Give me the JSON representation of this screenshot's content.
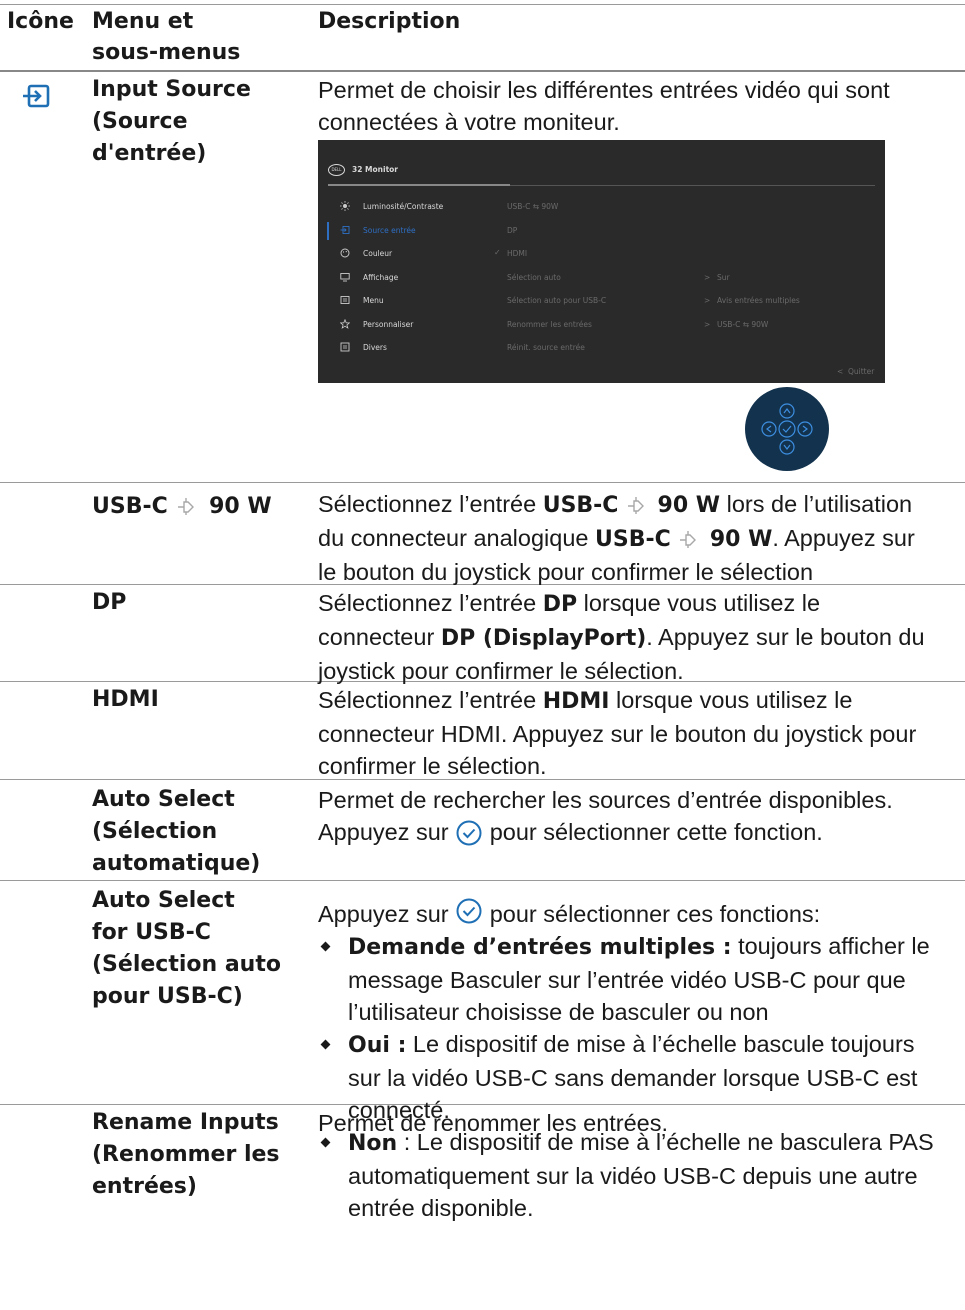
{
  "header": {
    "col_icon": "Icône",
    "col_menu_1": "Menu et",
    "col_menu_2": "sous-menus",
    "col_desc": "Description"
  },
  "rows": {
    "input_source": {
      "menu": [
        "Input Source",
        "(Source",
        "d'entrée)"
      ],
      "desc": [
        "Permet de choisir les différentes entrées vidéo qui sont",
        "connectées à votre moniteur."
      ],
      "icon": "input-source-icon"
    },
    "usbc": {
      "menu_a": "USB-C",
      "menu_b": "90 W",
      "l1a": "Sélectionnez l’entrée ",
      "l1b": "USB-C",
      "l1c": "90 W",
      "l1d": " lors de l’utilisation",
      "l2a": "du connecteur analogique ",
      "l2b": "USB-C",
      "l2c": "90 W",
      "l2d": ". Appuyez sur",
      "l3": "le bouton du joystick pour confirmer le sélection"
    },
    "dp": {
      "menu": "DP",
      "l1a": "Sélectionnez l’entrée ",
      "l1b": "DP",
      "l1c": " lorsque vous utilisez le",
      "l2a": "connecteur ",
      "l2b": "DP (DisplayPort)",
      "l2c": ". Appuyez sur le bouton du",
      "l3": "joystick pour confirmer le sélection."
    },
    "hdmi": {
      "menu": "HDMI",
      "l1a": "Sélectionnez l’entrée ",
      "l1b": "HDMI",
      "l1c": " lorsque vous utilisez le",
      "l2": "connecteur HDMI. Appuyez sur le bouton du joystick pour",
      "l3": "confirmer le sélection."
    },
    "auto_select": {
      "menu": [
        "Auto Select",
        "(Sélection",
        "automatique)"
      ],
      "l1": "Permet de rechercher les sources d’entrée disponibles.",
      "l2a": "Appuyez sur ",
      "l2b": " pour sélectionner cette fonction."
    },
    "auto_usbc": {
      "menu": [
        "Auto Select",
        "for USB-C",
        "(Sélection auto",
        "pour USB-C)"
      ],
      "intro_a": "Appuyez sur ",
      "intro_b": " pour sélectionner ces fonctions:",
      "b1_bold": "Demande d’entrées multiples :",
      "b1_l1": " toujours afficher le",
      "b1_l2": "message Basculer sur l’entrée vidéo USB-C pour que",
      "b1_l3": "l’utilisateur choisisse de basculer ou non",
      "b2_bold": "Oui :",
      "b2_l1": " Le dispositif de mise à l’échelle bascule toujours",
      "b2_l2": "sur la vidéo USB-C sans demander lorsque USB-C est",
      "b2_l3": "connecté.",
      "b3_bold": "Non",
      "b3_l1": " : Le dispositif de mise à l’échelle ne basculera PAS",
      "b3_l2": "automatiquement sur la vidéo USB-C depuis une autre",
      "b3_l3": "entrée disponible."
    },
    "rename": {
      "menu": [
        "Rename Inputs",
        "(Renommer les",
        "entrées)"
      ],
      "desc": "Permet de renommer les entrées."
    }
  },
  "osd": {
    "logo": "DELL",
    "title": "32 Monitor",
    "menu_items": [
      "Luminosité/Contraste",
      "Source entrée",
      "Couleur",
      "Affichage",
      "Menu",
      "Personnaliser",
      "Divers"
    ],
    "menu_icons": [
      "brightness-icon",
      "input-source-icon",
      "color-palette-icon",
      "display-icon",
      "menu-icon",
      "star-icon",
      "misc-icon"
    ],
    "sub_items": [
      "USB-C ⇆ 90W",
      "DP",
      "HDMI",
      "Sélection auto",
      "Sélection auto pour USB-C",
      "Renommer les entrées",
      "Réinit. source entrée"
    ],
    "values": [
      "Sur",
      "Avis entrées multiples",
      "USB-C ⇆ 90W"
    ],
    "quit": "Quitter",
    "selected_item": "Source entrée",
    "checked_sub": "HDMI",
    "colors": {
      "bg": "#2a2a2a",
      "accent": "#2e6fc4",
      "text": "#d8d8d8",
      "dim": "#6a6a6a",
      "joystick": "#12324d"
    }
  }
}
